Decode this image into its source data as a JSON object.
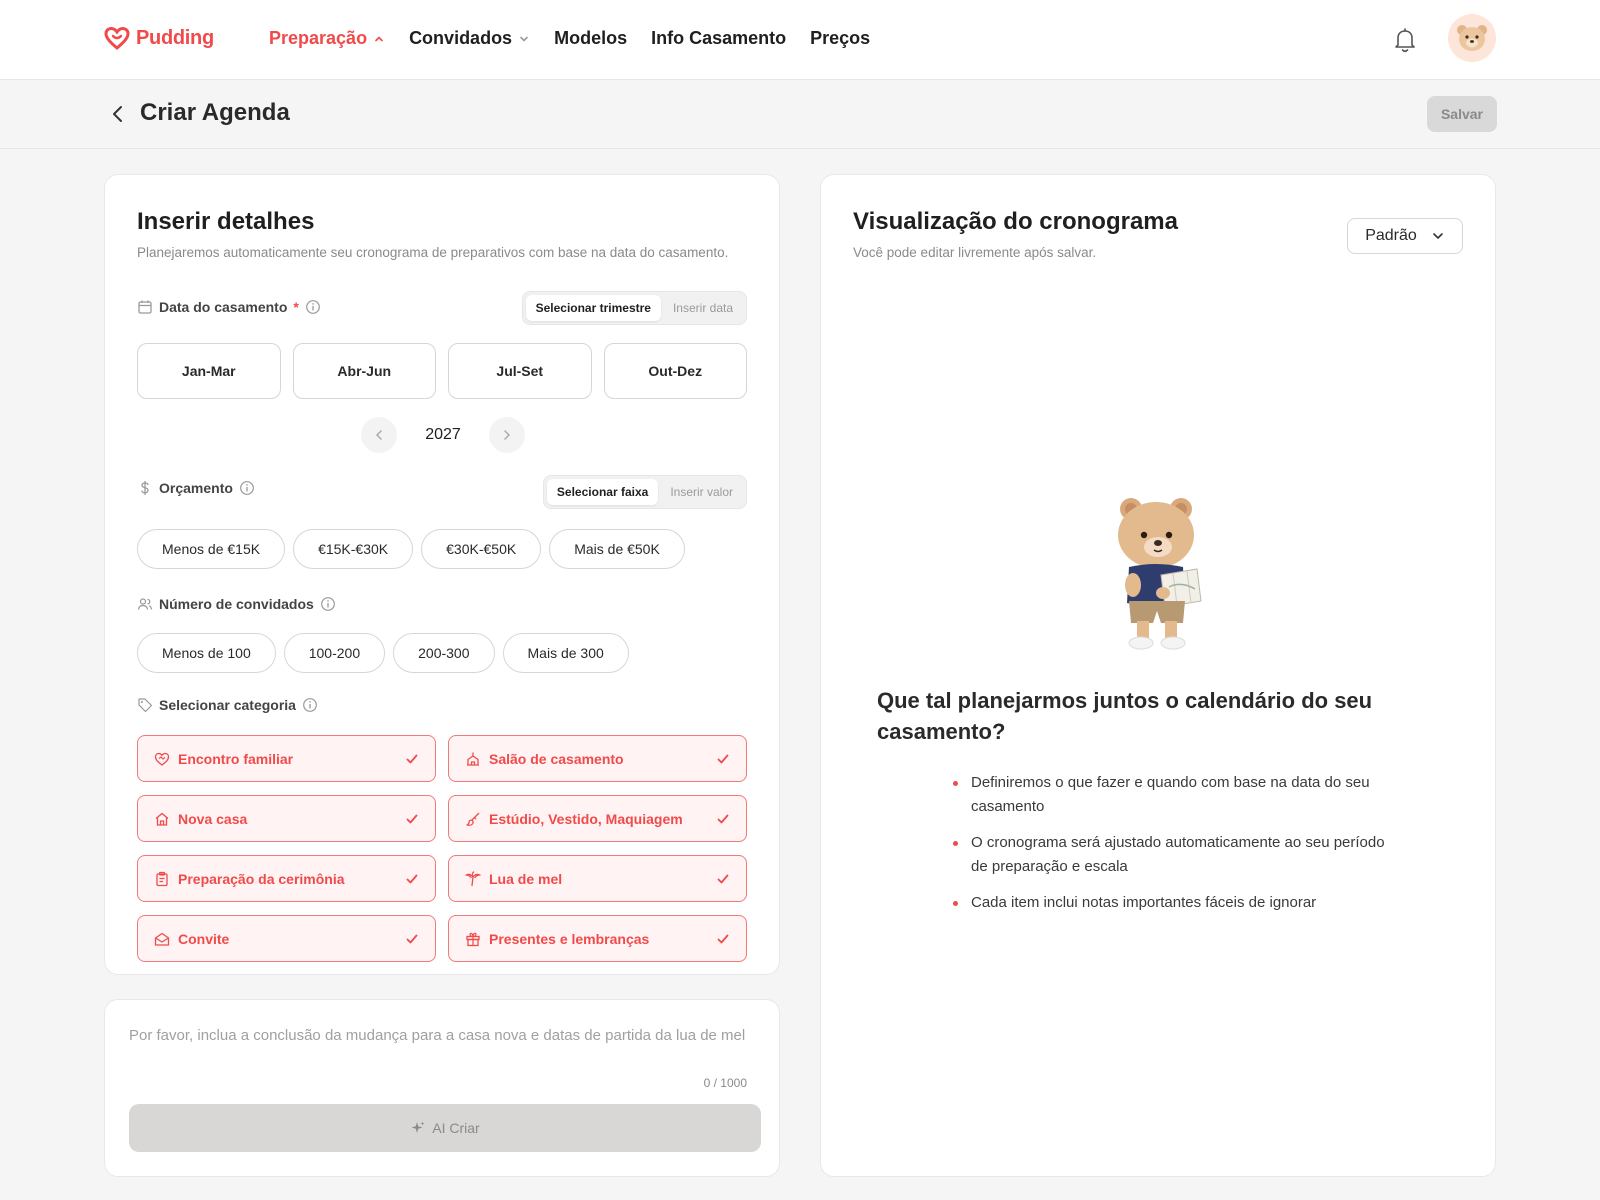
{
  "nav": {
    "brand": "Pudding",
    "items": [
      {
        "label": "Preparação",
        "active": true,
        "chevron": "up"
      },
      {
        "label": "Convidados",
        "active": false,
        "chevron": "down"
      },
      {
        "label": "Modelos",
        "active": false
      },
      {
        "label": "Info Casamento",
        "active": false
      },
      {
        "label": "Preços",
        "active": false
      }
    ],
    "icons": {
      "notification": "bell-icon",
      "avatar": "bear-avatar"
    }
  },
  "header": {
    "title": "Criar Agenda",
    "save_label": "Salvar"
  },
  "details": {
    "title": "Inserir detalhes",
    "subtitle": "Planejaremos automaticamente seu cronograma de preparativos com base na data do casamento.",
    "wedding_date": {
      "label": "Data do casamento",
      "required_mark": "*",
      "mode_options": [
        "Selecionar trimestre",
        "Inserir data"
      ],
      "selected_mode": "Selecionar trimestre",
      "quarters": [
        "Jan-Mar",
        "Abr-Jun",
        "Jul-Set",
        "Out-Dez"
      ],
      "year": "2027"
    },
    "budget": {
      "label": "Orçamento",
      "mode_options": [
        "Selecionar faixa",
        "Inserir valor"
      ],
      "selected_mode": "Selecionar faixa",
      "ranges": [
        "Menos de €15K",
        "€15K-€30K",
        "€30K-€50K",
        "Mais de €50K"
      ]
    },
    "guests": {
      "label": "Número de convidados",
      "ranges": [
        "Menos de 100",
        "100-200",
        "200-300",
        "Mais de 300"
      ]
    },
    "category": {
      "label": "Selecionar categoria",
      "items": [
        {
          "label": "Encontro familiar",
          "icon": "heart-handshake-icon",
          "checked": true
        },
        {
          "label": "Salão de casamento",
          "icon": "venue-icon",
          "checked": true
        },
        {
          "label": "Nova casa",
          "icon": "home-icon",
          "checked": true
        },
        {
          "label": "Estúdio, Vestido, Maquiagem",
          "icon": "brush-icon",
          "checked": true
        },
        {
          "label": "Preparação da cerimônia",
          "icon": "clipboard-icon",
          "checked": true
        },
        {
          "label": "Lua de mel",
          "icon": "palm-icon",
          "checked": true
        },
        {
          "label": "Convite",
          "icon": "mail-open-icon",
          "checked": true
        },
        {
          "label": "Presentes e lembranças",
          "icon": "gift-icon",
          "checked": true
        }
      ]
    }
  },
  "prompt": {
    "placeholder": "Por favor, inclua a conclusão da mudança para a casa nova e datas de partida da lua de mel",
    "counter": "0 / 1000",
    "ai_button": "AI Criar"
  },
  "preview": {
    "title": "Visualização do cronograma",
    "subtitle": "Você pode editar livremente após salvar.",
    "dropdown_value": "Padrão",
    "cta_title": "Que tal planejarmos juntos o calendário do seu casamento?",
    "bullets": [
      "Definiremos o que fazer e quando com base na data do seu casamento",
      "O cronograma será ajustado automaticamente ao seu período de preparação e escala",
      "Cada item inclui notas importantes fáceis de ignorar"
    ]
  },
  "colors": {
    "accent": "#f04a4a",
    "accent_bg": "#fff3f3",
    "disabled": "#d9d9d9"
  }
}
